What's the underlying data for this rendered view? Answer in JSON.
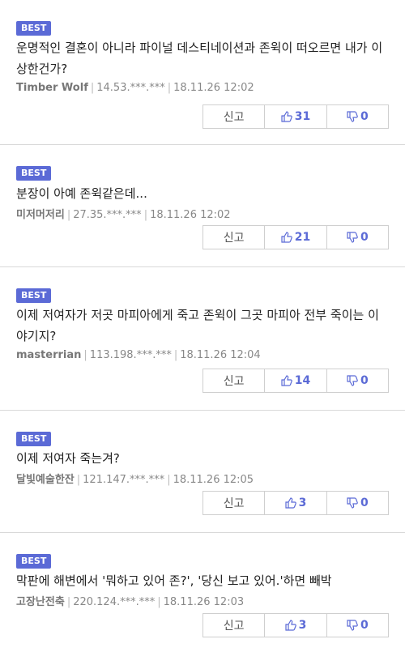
{
  "comments": [
    {
      "badge": "BEST",
      "text": "운명적인 결혼이 아니라 파이널 데스티네이션과 존윅이 떠오르면 내가 이상한건가?",
      "author": "Timber Wolf",
      "ip": "14.53.***.***",
      "date": "18.11.26 12:02",
      "report_label": "신고",
      "upvotes": "31",
      "downvotes": "0"
    },
    {
      "badge": "BEST",
      "text": "분장이 아예 존윅같은데...",
      "author": "미저머저리",
      "ip": "27.35.***.***",
      "date": "18.11.26 12:02",
      "report_label": "신고",
      "upvotes": "21",
      "downvotes": "0"
    },
    {
      "badge": "BEST",
      "text": "이제 저여자가 저곳 마피아에게 죽고 존윅이 그곳 마피아 전부 죽이는 이야기지?",
      "author": "masterrian",
      "ip": "113.198.***.***",
      "date": "18.11.26 12:04",
      "report_label": "신고",
      "upvotes": "14",
      "downvotes": "0"
    },
    {
      "badge": "BEST",
      "text": "이제 저여자 죽는겨?",
      "author": "달빛예술한잔",
      "ip": "121.147.***.***",
      "date": "18.11.26 12:05",
      "report_label": "신고",
      "upvotes": "3",
      "downvotes": "0"
    },
    {
      "badge": "BEST",
      "text": "막판에 해변에서 '뭐하고 있어 존?', '당신 보고 있어.'하면 빼박",
      "author": "고장난전축",
      "ip": "220.124.***.***",
      "date": "18.11.26 12:03",
      "report_label": "신고",
      "upvotes": "3",
      "downvotes": "0"
    }
  ],
  "colors": {
    "badge": "#5b6ad6",
    "accent": "#5b6ad6"
  },
  "icons": {
    "up": "thumbs-up-icon",
    "down": "thumbs-down-icon"
  }
}
